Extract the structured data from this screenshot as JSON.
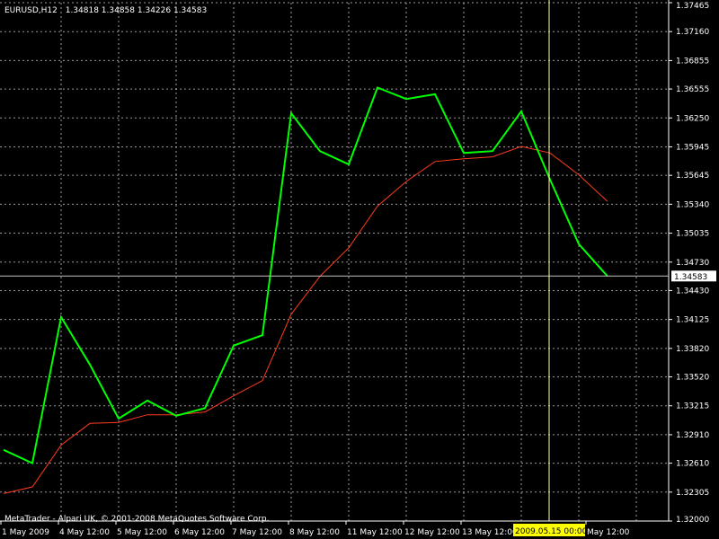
{
  "header": {
    "symbol": "EURUSD,H12",
    "ohlc": "1.34818 1.34858 1.34226 1.34583"
  },
  "copyright": "MetaTrader - Alpari UK, © 2001-2008 MetaQuotes Software Corp.",
  "colors": {
    "background": "#000000",
    "grid": "#cfcfcf",
    "axis": "#ffffff",
    "text": "#ffffff",
    "price_line": "#00ff00",
    "ma_line": "#ff3b1f",
    "crosshair": "#ffffb0",
    "crosshair_label_bg": "#ffff00",
    "bid_label_bg": "#ffffff"
  },
  "chart_data": {
    "type": "line",
    "title": "EURUSD,H12",
    "ylim": [
      1.32,
      1.37465
    ],
    "y_ticks": [
      "1.37465",
      "1.37160",
      "1.36855",
      "1.36555",
      "1.36250",
      "1.35945",
      "1.35645",
      "1.35340",
      "1.35035",
      "1.34730",
      "1.34430",
      "1.34125",
      "1.33820",
      "1.33520",
      "1.33215",
      "1.32910",
      "1.32610",
      "1.32305",
      "1.32000"
    ],
    "x_tick_labels": [
      "1 May 2009",
      "4 May 12:00",
      "5 May 12:00",
      "6 May 12:00",
      "7 May 12:00",
      "8 May 12:00",
      "11 May 12:00",
      "12 May 12:00",
      "13 May 12:00",
      "May 12:00"
    ],
    "current_price": "1.34583",
    "crosshair_time": "2009.05.15 00:00",
    "series": [
      {
        "values": [
          1.3275,
          1.3261,
          1.3415,
          1.3365,
          1.3308,
          1.3327,
          1.3311,
          1.3319,
          1.3385,
          1.3396,
          1.363,
          1.359,
          1.3576,
          1.3657,
          1.3645,
          1.365,
          1.3588,
          1.359,
          1.3632,
          1.356,
          1.3492,
          1.3458
        ]
      },
      {
        "values": [
          1.3229,
          1.3236,
          1.328,
          1.3303,
          1.3304,
          1.3312,
          1.3312,
          1.3315,
          1.3332,
          1.3348,
          1.3418,
          1.3458,
          1.3488,
          1.3532,
          1.3558,
          1.3579,
          1.3582,
          1.3584,
          1.3595,
          1.3588,
          1.3565,
          1.3537
        ]
      }
    ]
  }
}
